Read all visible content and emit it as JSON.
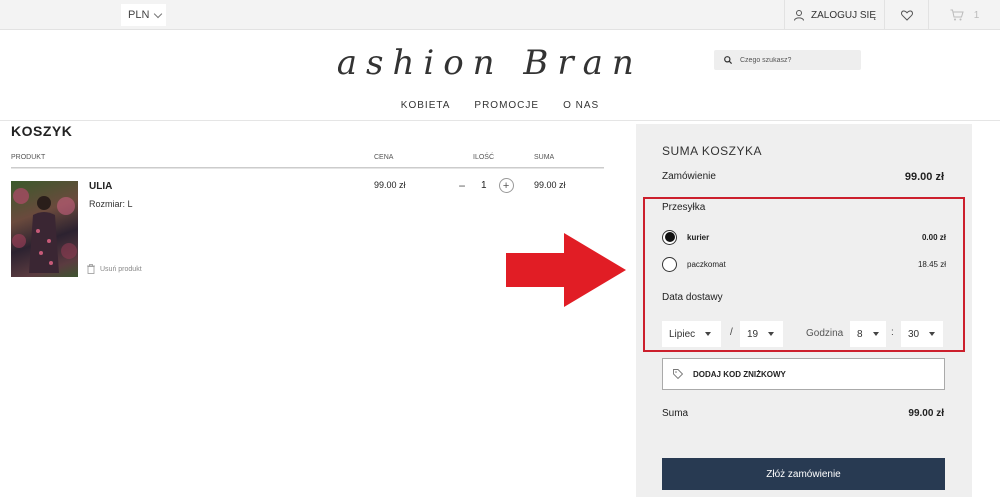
{
  "topbar": {
    "currency": "PLN",
    "login_label": "ZALOGUJ SIĘ",
    "cart_count": "1"
  },
  "header": {
    "logo_text": "Fashion Brand",
    "search_placeholder": "Czego szukasz?",
    "nav": [
      "KOBIETA",
      "PROMOCJE",
      "O NAS"
    ]
  },
  "cart": {
    "title": "KOSZYK",
    "columns": {
      "product": "PRODUKT",
      "price": "CENA",
      "quantity": "ILOŚĆ",
      "sum": "SUMA"
    },
    "item": {
      "name": "ULIA",
      "size": "Rozmiar: L",
      "remove": "Usuń produkt",
      "price": "99.00 zł",
      "quantity": "1",
      "sum": "99.00 zł"
    }
  },
  "summary": {
    "title": "SUMA KOSZYKA",
    "order_label": "Zamówienie",
    "order_value": "99.00 zł",
    "shipping_label": "Przesyłka",
    "options": [
      {
        "name": "kurier",
        "price": "0.00 zł",
        "selected": true
      },
      {
        "name": "paczkomat",
        "price": "18.45 zł",
        "selected": false
      }
    ],
    "date_label": "Data dostawy",
    "month": "Lipiec",
    "day": "19",
    "date_sep": "/",
    "hour_label": "Godzina",
    "hour": "8",
    "time_sep": ":",
    "minute": "30",
    "discount_label": "DODAJ KOD ZNIŻKOWY",
    "total_label": "Suma",
    "total_value": "99.00 zł",
    "submit_label": "Złóż zamówienie"
  },
  "colors": {
    "highlight": "#cc1f2c",
    "submit_bg": "#283a52",
    "arrow": "#e11d25"
  }
}
